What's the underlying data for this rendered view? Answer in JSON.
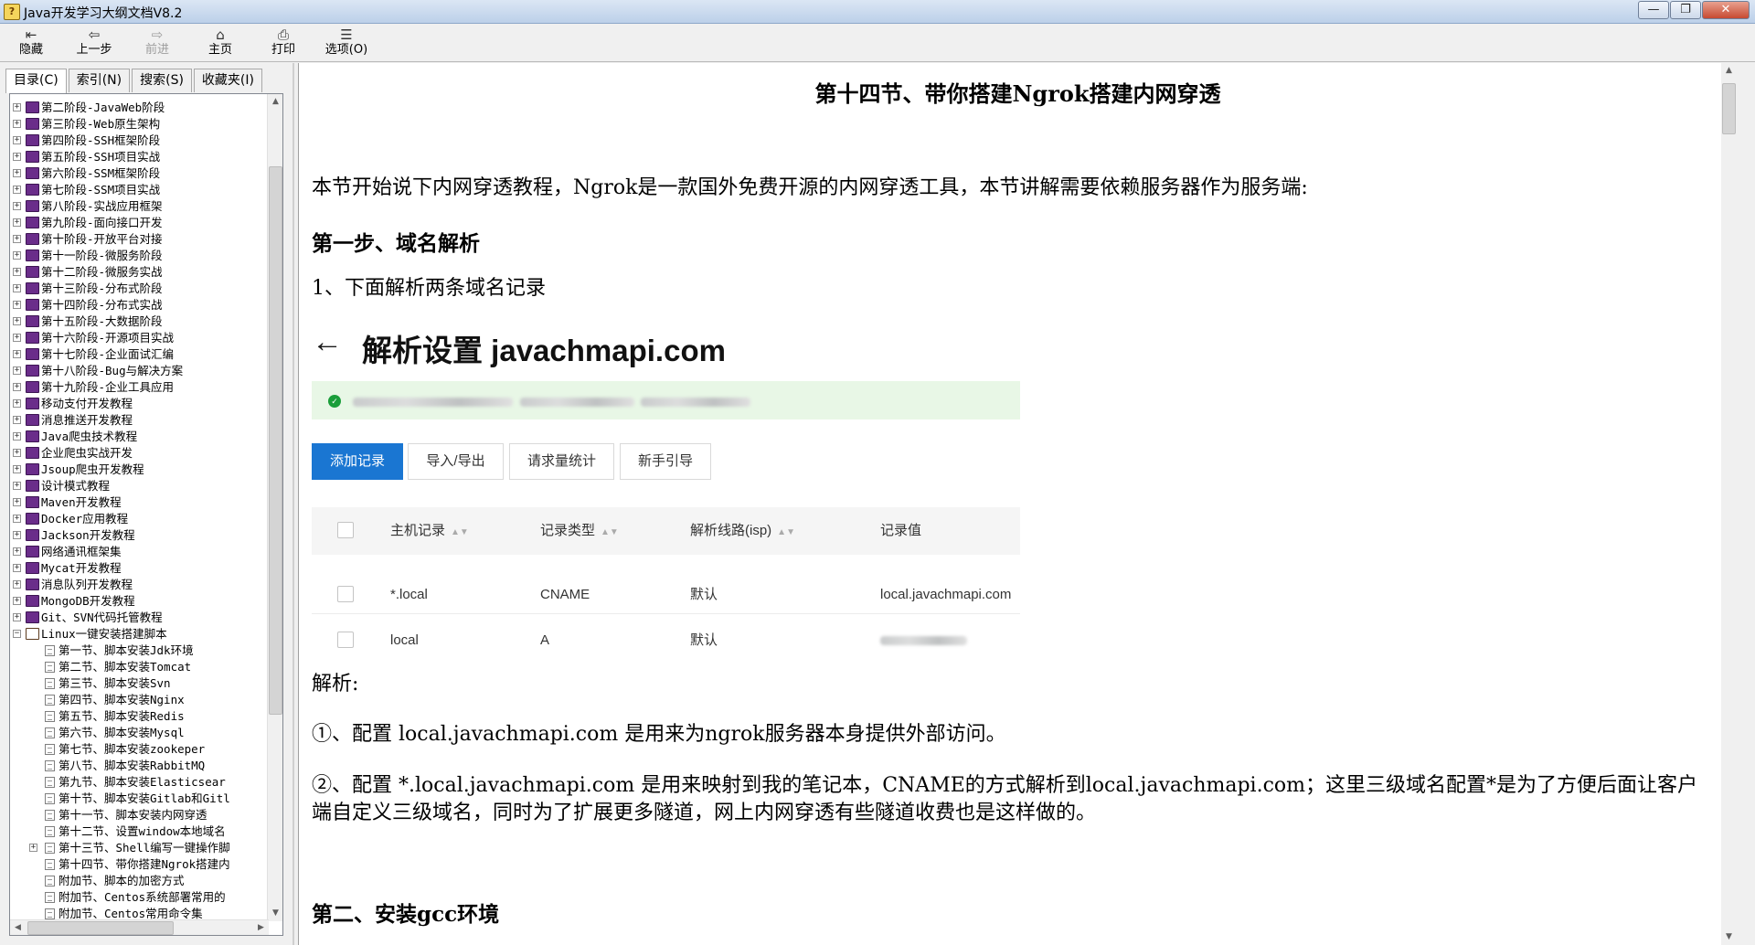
{
  "window": {
    "title": "Java开发学习大纲文档V8.2",
    "buttons": [
      "—",
      "❐",
      "✕"
    ]
  },
  "toolbar": {
    "buttons": [
      {
        "label": "隐藏",
        "icon": "hide-icon",
        "glyph": "⇤"
      },
      {
        "label": "上一步",
        "icon": "back-icon",
        "glyph": "⇦"
      },
      {
        "label": "前进",
        "icon": "forward-icon",
        "glyph": "⇨"
      },
      {
        "label": "主页",
        "icon": "home-icon",
        "glyph": "⌂"
      },
      {
        "label": "打印",
        "icon": "print-icon",
        "glyph": "⎙"
      },
      {
        "label": "选项(O)",
        "icon": "options-icon",
        "glyph": "☰"
      }
    ]
  },
  "sidebar": {
    "tabs": [
      "目录(C)",
      "索引(N)",
      "搜索(S)",
      "收藏夹(I)"
    ],
    "tree": [
      {
        "label": "第二阶段-JavaWeb阶段",
        "type": "book"
      },
      {
        "label": "第三阶段-Web原生架构",
        "type": "book"
      },
      {
        "label": "第四阶段-SSH框架阶段",
        "type": "book"
      },
      {
        "label": "第五阶段-SSH项目实战",
        "type": "book"
      },
      {
        "label": "第六阶段-SSM框架阶段",
        "type": "book"
      },
      {
        "label": "第七阶段-SSM项目实战",
        "type": "book"
      },
      {
        "label": "第八阶段-实战应用框架",
        "type": "book"
      },
      {
        "label": "第九阶段-面向接口开发",
        "type": "book"
      },
      {
        "label": "第十阶段-开放平台对接",
        "type": "book"
      },
      {
        "label": "第十一阶段-微服务阶段",
        "type": "book"
      },
      {
        "label": "第十二阶段-微服务实战",
        "type": "book"
      },
      {
        "label": "第十三阶段-分布式阶段",
        "type": "book"
      },
      {
        "label": "第十四阶段-分布式实战",
        "type": "book"
      },
      {
        "label": "第十五阶段-大数据阶段",
        "type": "book"
      },
      {
        "label": "第十六阶段-开源项目实战",
        "type": "book"
      },
      {
        "label": "第十七阶段-企业面试汇编",
        "type": "book"
      },
      {
        "label": "第十八阶段-Bug与解决方案",
        "type": "book"
      },
      {
        "label": "第十九阶段-企业工具应用",
        "type": "book"
      },
      {
        "label": "移动支付开发教程",
        "type": "book"
      },
      {
        "label": "消息推送开发教程",
        "type": "book"
      },
      {
        "label": "Java爬虫技术教程",
        "type": "book"
      },
      {
        "label": "企业爬虫实战开发",
        "type": "book"
      },
      {
        "label": "Jsoup爬虫开发教程",
        "type": "book"
      },
      {
        "label": "设计模式教程",
        "type": "book"
      },
      {
        "label": "Maven开发教程",
        "type": "book"
      },
      {
        "label": "Docker应用教程",
        "type": "book"
      },
      {
        "label": "Jackson开发教程",
        "type": "book"
      },
      {
        "label": "网络通讯框架集",
        "type": "book"
      },
      {
        "label": "Mycat开发教程",
        "type": "book"
      },
      {
        "label": "消息队列开发教程",
        "type": "book"
      },
      {
        "label": "MongoDB开发教程",
        "type": "book"
      },
      {
        "label": "Git、SVN代码托管教程",
        "type": "book"
      },
      {
        "label": "Linux一键安装搭建脚本",
        "type": "open"
      },
      {
        "label": "第一节、脚本安装Jdk环境",
        "type": "page"
      },
      {
        "label": "第二节、脚本安装Tomcat",
        "type": "page"
      },
      {
        "label": "第三节、脚本安装Svn",
        "type": "page"
      },
      {
        "label": "第四节、脚本安装Nginx",
        "type": "page"
      },
      {
        "label": "第五节、脚本安装Redis",
        "type": "page"
      },
      {
        "label": "第六节、脚本安装Mysql",
        "type": "page"
      },
      {
        "label": "第七节、脚本安装zookeper",
        "type": "page"
      },
      {
        "label": "第八节、脚本安装RabbitMQ",
        "type": "page"
      },
      {
        "label": "第九节、脚本安装Elasticsear",
        "type": "page"
      },
      {
        "label": "第十节、脚本安装Gitlab和Gitl",
        "type": "page"
      },
      {
        "label": "第十一节、脚本安装内网穿透",
        "type": "page"
      },
      {
        "label": "第十二节、设置window本地域名",
        "type": "page"
      },
      {
        "label": "第十三节、Shell编写一键操作脚",
        "type": "pageplus"
      },
      {
        "label": "第十四节、带你搭建Ngrok搭建内",
        "type": "page"
      },
      {
        "label": "附加节、脚本的加密方式",
        "type": "page"
      },
      {
        "label": "附加节、Centos系统部署常用的",
        "type": "page"
      },
      {
        "label": "附加节、Centos常用命令集",
        "type": "page"
      }
    ]
  },
  "article": {
    "title": "第十四节、带你搭建Ngrok搭建内网穿透",
    "intro": "本节开始说下内网穿透教程，Ngrok是一款国外免费开源的内网穿透工具，本节讲解需要依赖服务器作为服务端:",
    "step1": "第一步、域名解析",
    "step1_item": "1、下面解析两条域名记录",
    "analysis": "解析:",
    "point1": "①、配置 local.javachmapi.com 是用来为ngrok服务器本身提供外部访问。",
    "point2": "②、配置 *.local.javachmapi.com 是用来映射到我的笔记本，CNAME的方式解析到local.javachmapi.com；这里三级域名配置*是为了方便后面让客户端自定义三级域名，同时为了扩展更多隧道，网上内网穿透有些隧道收费也是这样做的。",
    "step2": "第二、安装gcc环境"
  },
  "dns_screenshot": {
    "back": "←",
    "title": "解析设置 javachmapi.com",
    "buttons": [
      "添加记录",
      "导入/导出",
      "请求量统计",
      "新手引导"
    ],
    "columns": [
      "主机记录",
      "记录类型",
      "解析线路(isp)",
      "记录值"
    ],
    "rows": [
      {
        "host": "*.local",
        "type": "CNAME",
        "line": "默认",
        "value": "local.javachmapi.com"
      },
      {
        "host": "local",
        "type": "A",
        "line": "默认",
        "value": ""
      }
    ],
    "colors": {
      "primary": "#1a76d2",
      "notice_bg": "#e8f7e6",
      "ok": "#1a9e3a"
    }
  }
}
